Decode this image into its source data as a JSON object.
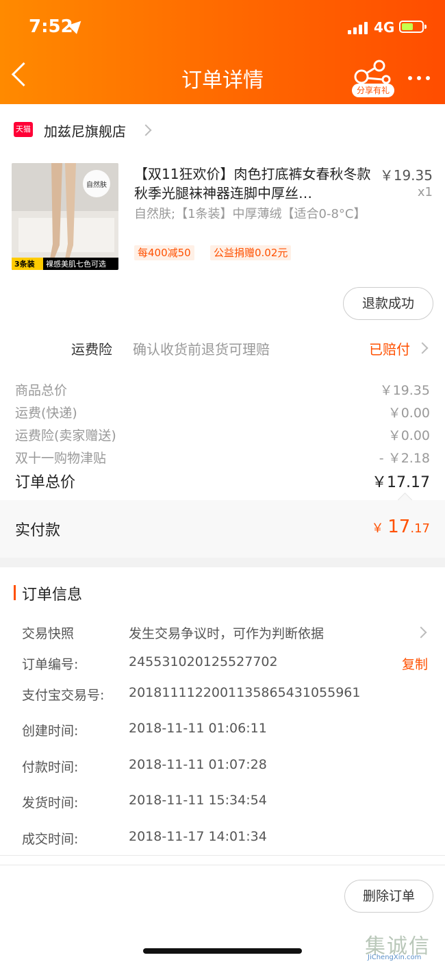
{
  "status_bar": {
    "time": "7:52",
    "network": "4G"
  },
  "nav": {
    "title": "订单详情",
    "share_label": "分享有礼"
  },
  "shop": {
    "badge": "天猫",
    "name": "加兹尼旗舰店"
  },
  "product": {
    "thumb_brand": "自然肤",
    "thumb_banner_left": "3条装",
    "thumb_banner_right": "裸感美肌七色可选",
    "title": "【双11狂欢价】肉色打底裤女春秋冬款秋季光腿袜神器连脚中厚丝…",
    "price": "￥19.35",
    "qty": "x1",
    "sku": "自然肤;【1条装】中厚薄绒【适合0-8°C】",
    "tags": [
      "每400减50",
      "公益捐赠0.02元"
    ]
  },
  "refund_button": "退款成功",
  "insurance": {
    "label": "运费险",
    "desc": "确认收货前退货可理赔",
    "status": "已赔付"
  },
  "summary": {
    "rows": [
      {
        "label": "商品总价",
        "value": "￥19.35"
      },
      {
        "label": "运费(快递)",
        "value": "￥0.00"
      },
      {
        "label": "运费险(卖家赠送)",
        "value": "￥0.00"
      },
      {
        "label": "双十一购物津贴",
        "value": "- ￥2.18"
      }
    ],
    "total_label": "订单总价",
    "total_value": "￥17.17",
    "paid_label": "实付款",
    "paid_currency": "￥",
    "paid_int": "17",
    "paid_dec": ".17"
  },
  "order_info": {
    "title": "订单信息",
    "rows": [
      {
        "label": "交易快照",
        "value": "发生交易争议时，可作为判断依据"
      },
      {
        "label": "订单编号:",
        "value": "245531020125527702"
      },
      {
        "label": "支付宝交易号:",
        "value": "2018111122001135865431055961"
      },
      {
        "label": "创建时间:",
        "value": "2018-11-11 01:06:11"
      },
      {
        "label": "付款时间:",
        "value": "2018-11-11 01:07:28"
      },
      {
        "label": "发货时间:",
        "value": "2018-11-11 15:34:54"
      },
      {
        "label": "成交时间:",
        "value": "2018-11-17 14:01:34"
      }
    ],
    "copy_label": "复制"
  },
  "delete_button": "删除订单",
  "watermark": {
    "cn": "集诚信",
    "en": "JiChengXin.com"
  },
  "colors": {
    "accent": "#ff5000",
    "header_start": "#ff8a00",
    "header_end": "#ff4d00"
  }
}
